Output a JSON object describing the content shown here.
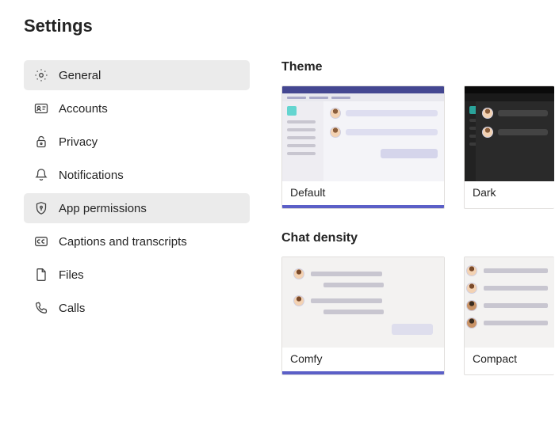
{
  "page_title": "Settings",
  "sidebar": {
    "items": [
      {
        "label": "General",
        "icon": "gear-icon",
        "selected": true
      },
      {
        "label": "Accounts",
        "icon": "id-card-icon"
      },
      {
        "label": "Privacy",
        "icon": "lock-icon"
      },
      {
        "label": "Notifications",
        "icon": "bell-icon"
      },
      {
        "label": "App permissions",
        "icon": "shield-key-icon",
        "highlight": true
      },
      {
        "label": "Captions and transcripts",
        "icon": "cc-icon"
      },
      {
        "label": "Files",
        "icon": "file-icon"
      },
      {
        "label": "Calls",
        "icon": "phone-icon"
      }
    ]
  },
  "sections": {
    "theme": {
      "title": "Theme",
      "options": [
        {
          "label": "Default",
          "selected": true
        },
        {
          "label": "Dark"
        }
      ]
    },
    "chat_density": {
      "title": "Chat density",
      "options": [
        {
          "label": "Comfy",
          "selected": true
        },
        {
          "label": "Compact"
        }
      ]
    }
  },
  "colors": {
    "accent": "#5b5fc7",
    "teams_brand": "#444791"
  }
}
